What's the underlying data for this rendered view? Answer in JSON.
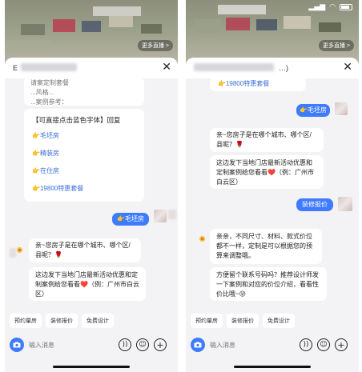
{
  "colors": {
    "accent": "#3f7bff",
    "link": "#3a6fd8",
    "bubble_bg": "#ffffff",
    "chat_bg": "#f3f3f6"
  },
  "left": {
    "header_title": "E",
    "more_live": "更多直播 >",
    "partial_top_lines": [
      "请案定制套餐",
      "...风格...",
      "...案例参考："
    ],
    "menu_intro": "【可直接点击蓝色字体】回复",
    "menu_items": [
      {
        "icon": "👉",
        "label": "毛坯房"
      },
      {
        "icon": "👉",
        "label": "精装房"
      },
      {
        "icon": "👉",
        "label": "在住房"
      },
      {
        "icon": "👉",
        "label": "19800特惠套餐"
      }
    ],
    "user_reply": "👉毛坯房",
    "question": "亲~您房子是在哪个城市、哪个区/县呢？🌹",
    "offer": "这边发下当地门店最新活动优惠和定制案例给您看看❤️（例：广州市白云区）"
  },
  "right": {
    "header_title": "…)",
    "more_live": "更多直播 >",
    "top_link": "👉19800特惠套餐",
    "user_reply_1": "👉毛坯房",
    "question": "亲~您房子是在哪个城市、哪个区/县呢？🌹",
    "offer": "这边发下当地门店最新活动优惠和定制案例给您看看❤️（例：广州市白云区）",
    "user_reply_2": "装修报价",
    "price_reply": "亲亲，不同尺寸、材料、款式价位都不一样，定制是可以根据您的预算来调整哦。",
    "contact_request": "方便留个联系号码吗？推荐设计师发一下案例和对应的价位介绍，看看性价比哦~😜"
  },
  "quick_actions": [
    "预约量房",
    "装修报价",
    "免费设计"
  ],
  "input_placeholder": "输入消息",
  "icons": {
    "camera": "camera-icon",
    "voice": "voice-icon",
    "emoji": "emoji-icon",
    "plus": "plus-icon",
    "close": "close-icon"
  }
}
